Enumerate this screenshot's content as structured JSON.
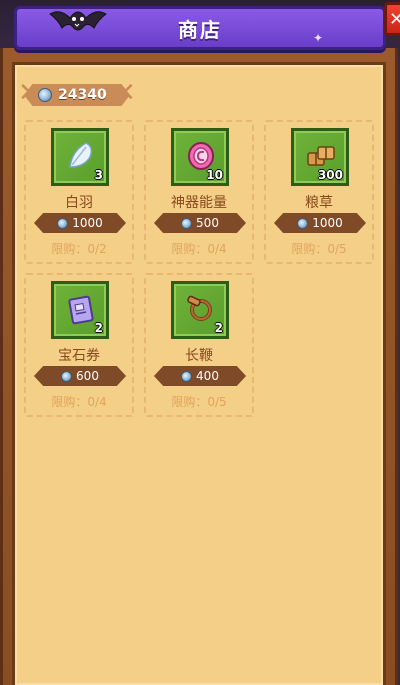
{
  "header": {
    "title": "商店",
    "close_label": "✕"
  },
  "currency": {
    "amount": "24340",
    "icon": "silver-coin-icon"
  },
  "items": [
    {
      "name": "白羽",
      "qty": "3",
      "price": "1000",
      "limit": "限购：0/2",
      "icon": "white-feather-icon"
    },
    {
      "name": "神器能量",
      "qty": "10",
      "price": "500",
      "limit": "限购：0/4",
      "icon": "pink-energy-orb-icon"
    },
    {
      "name": "粮草",
      "qty": "300",
      "price": "1000",
      "limit": "限购：0/5",
      "icon": "supply-bundle-icon"
    },
    {
      "name": "宝石券",
      "qty": "2",
      "price": "600",
      "limit": "限购：0/4",
      "icon": "gem-voucher-icon"
    },
    {
      "name": "长鞭",
      "qty": "2",
      "price": "400",
      "limit": "限购：0/5",
      "icon": "long-whip-icon"
    }
  ],
  "colors": {
    "banner": "#7a4cdb",
    "frame": "#8a4d22",
    "panel": "#f3cf88",
    "icon_bg": "#6fb33a",
    "price_bg": "#7e4a28",
    "name_text": "#8a4a1e",
    "limit_text": "#e2a35e"
  }
}
